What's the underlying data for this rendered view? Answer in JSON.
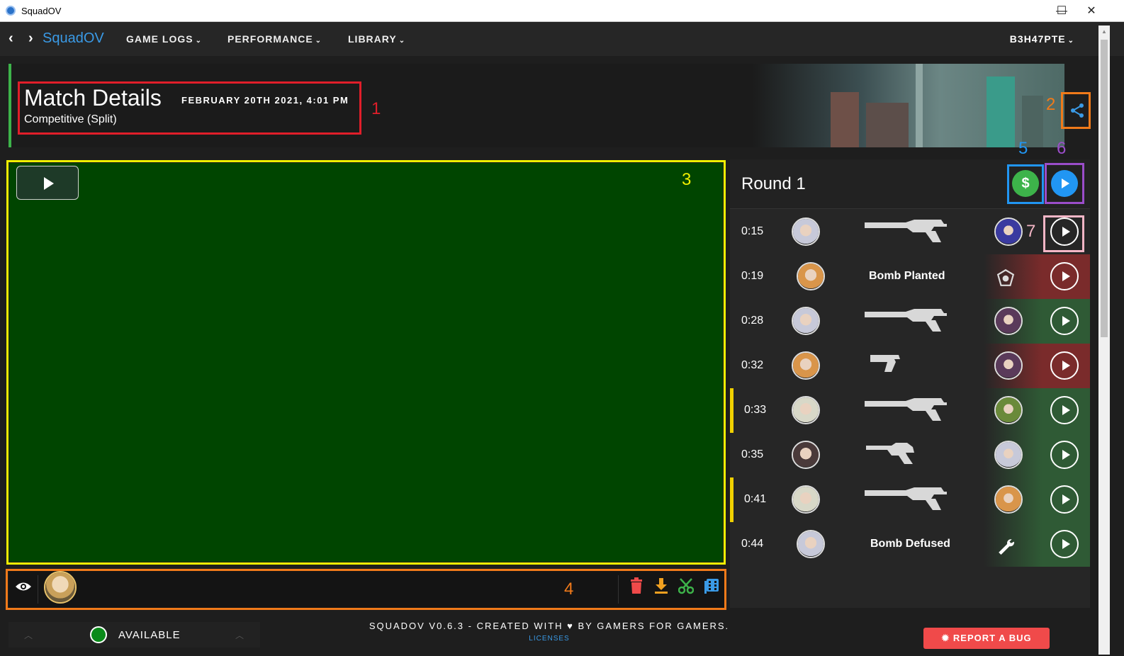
{
  "window": {
    "title": "SquadOV",
    "minimize": "—",
    "maximize": "☐",
    "close": "✕"
  },
  "nav": {
    "back": "‹",
    "forward": "›",
    "brand": "SquadOV",
    "items": [
      {
        "label": "GAME LOGS"
      },
      {
        "label": "PERFORMANCE"
      },
      {
        "label": "LIBRARY"
      }
    ],
    "chevron": "⌄",
    "user": "B3H47PTE"
  },
  "match": {
    "title": "Match Details",
    "date": "FEBRUARY 20TH 2021, 4:01 PM",
    "mode": "Competitive (Split)"
  },
  "annotations": {
    "n1": "1",
    "n2": "2",
    "n3": "3",
    "n4": "4",
    "n5": "5",
    "n6": "6",
    "n7": "7"
  },
  "round": {
    "title": "Round 1",
    "economy_symbol": "$"
  },
  "events": [
    {
      "time": "0:15",
      "label": "",
      "weapon": "vandal-gun-icon",
      "bg": "#262626"
    },
    {
      "time": "0:19",
      "label": "Bomb Planted",
      "weapon": "",
      "bg": "#7a2b2b"
    },
    {
      "time": "0:28",
      "label": "",
      "weapon": "vandal-gun-icon",
      "bg": "#2f5a35"
    },
    {
      "time": "0:32",
      "label": "",
      "weapon": "pistol-icon",
      "bg": "#7a2b2b"
    },
    {
      "time": "0:33",
      "label": "",
      "weapon": "vandal-gun-icon",
      "bg": "#2f5a35"
    },
    {
      "time": "0:35",
      "label": "",
      "weapon": "revolver-icon",
      "bg": "#2f5a35"
    },
    {
      "time": "0:41",
      "label": "",
      "weapon": "vandal-gun-icon",
      "bg": "#2f5a35"
    },
    {
      "time": "0:44",
      "label": "Bomb Defused",
      "weapon": "",
      "bg": "#2f5a35"
    }
  ],
  "status": {
    "label": "AVAILABLE"
  },
  "footer": {
    "text": "SQUADOV V0.6.3 - CREATED WITH ♥ BY GAMERS FOR GAMERS.",
    "link": "LICENSES",
    "bug": "REPORT A BUG"
  },
  "colors": {
    "accent": "#3a9ae6",
    "green": "#3db34a",
    "red": "#f04a4a"
  }
}
